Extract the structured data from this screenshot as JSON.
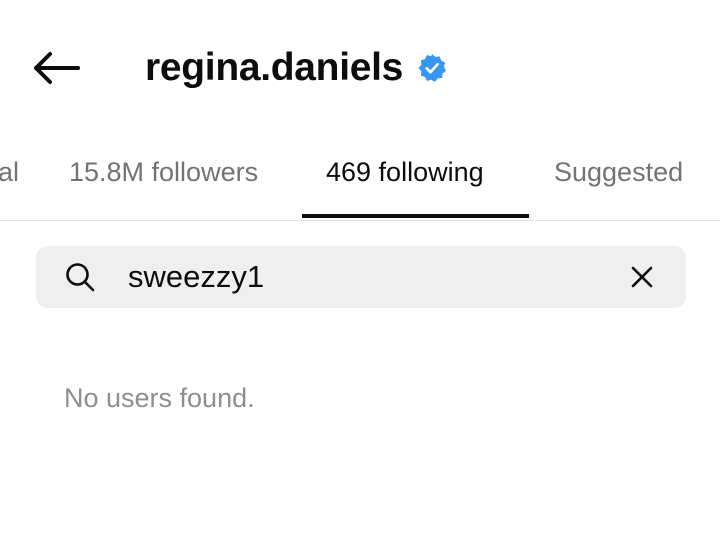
{
  "header": {
    "username": "regina.daniels",
    "verified": true,
    "back_icon": "arrow-left-icon",
    "verified_icon": "verified-badge-icon",
    "verified_color": "#3797f0"
  },
  "tabs": [
    {
      "label": "al",
      "active": false
    },
    {
      "label": "15.8M followers",
      "active": false
    },
    {
      "label": "469 following",
      "active": true
    },
    {
      "label": "Suggested",
      "active": false
    }
  ],
  "search": {
    "value": "sweezzy1",
    "icon": "search-icon",
    "clear_icon": "close-icon"
  },
  "results": {
    "empty_message": "No users found."
  },
  "colors": {
    "primary_text": "#0d0d0d",
    "secondary_text": "#737373",
    "search_bg": "#efefef",
    "divider": "#e4e4e4"
  }
}
